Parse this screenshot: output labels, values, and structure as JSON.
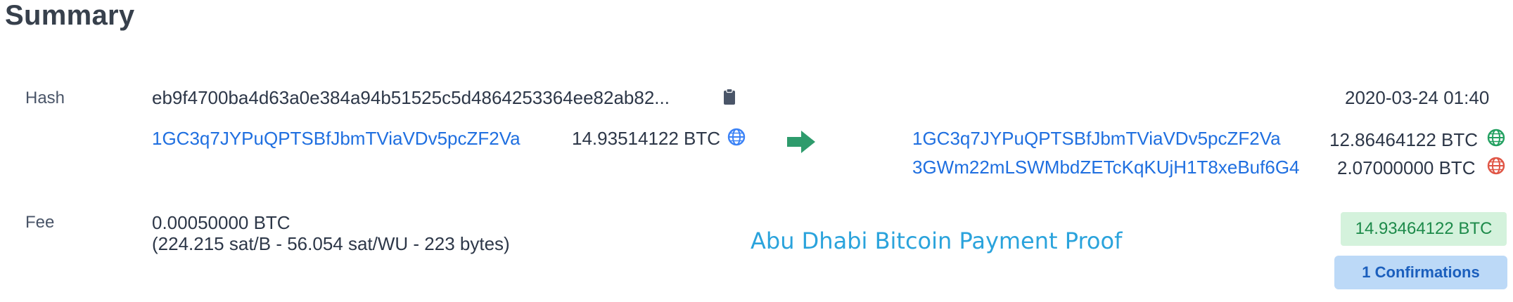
{
  "summary": {
    "title": "Summary"
  },
  "hash_row": {
    "label": "Hash",
    "hash_value": "eb9f4700ba4d63a0e384a94b51525c5d4864253364ee82ab82...",
    "timestamp": "2020-03-24 01:40"
  },
  "inputs": [
    {
      "address": "1GC3q7JYPuQPTSBfJbmTViaVDv5pcZF2Va",
      "amount": "14.93514122 BTC",
      "icon": "globe-icon",
      "icon_color": "#3b82f6"
    }
  ],
  "outputs": [
    {
      "address": "1GC3q7JYPuQPTSBfJbmTViaVDv5pcZF2Va",
      "amount": "12.86464122 BTC",
      "icon": "globe-icon",
      "icon_color": "#22a060"
    },
    {
      "address": "3GWm22mLSWMbdZETcKqKUjH1T8xeBuf6G4",
      "amount": "2.07000000 BTC",
      "icon": "globe-icon",
      "icon_color": "#e05545"
    }
  ],
  "fee_row": {
    "label": "Fee",
    "fee_value": "0.00050000 BTC",
    "fee_detail": "(224.215 sat/B - 56.054 sat/WU - 223 bytes)"
  },
  "watermark": "Abu Dhabi Bitcoin Payment Proof",
  "totals": {
    "total_amount": "14.93464122 BTC",
    "confirmations": "1 Confirmations"
  },
  "colors": {
    "link": "#1f6fe0",
    "arrow": "#2e9b6c",
    "badge_green_bg": "#d4f2dc",
    "badge_blue_bg": "#bcd9f7"
  }
}
